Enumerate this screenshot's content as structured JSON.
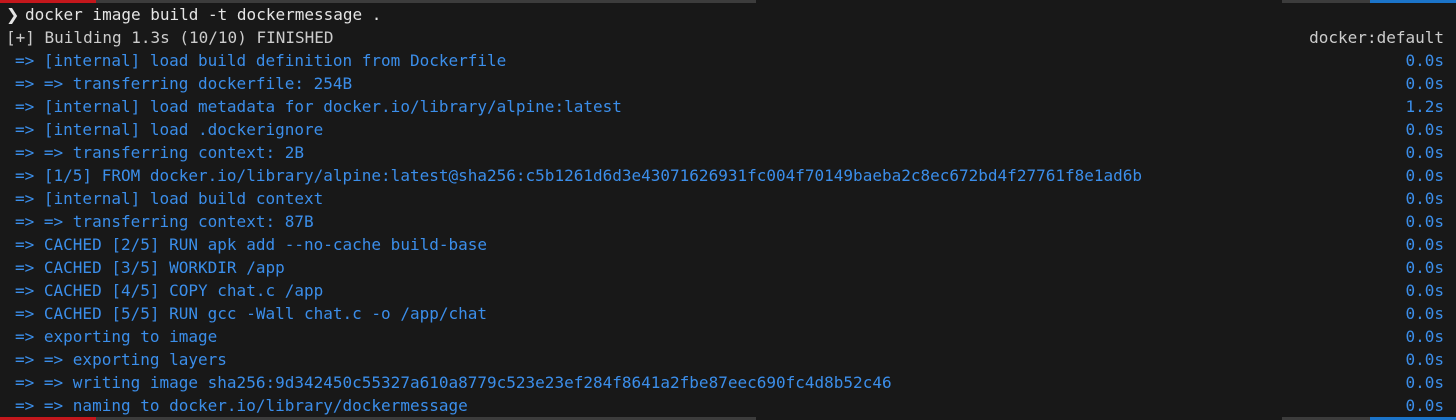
{
  "colors": {
    "background": "#181818",
    "text": "#cccccc",
    "command_text": "#e5e5e5",
    "step_text": "#3b8eea",
    "accent_red": "#c4171c",
    "accent_blue": "#1b74c9",
    "bar_gray": "#3c3c3c"
  },
  "prompt": {
    "chevron": "❯",
    "command": "docker image build -t dockermessage ."
  },
  "header": {
    "status": "[+] Building 1.3s (10/10) FINISHED",
    "builder": "docker:default"
  },
  "steps": [
    {
      "text": "=> [internal] load build definition from Dockerfile",
      "time": "0.0s"
    },
    {
      "text": "=> => transferring dockerfile: 254B",
      "time": "0.0s"
    },
    {
      "text": "=> [internal] load metadata for docker.io/library/alpine:latest",
      "time": "1.2s"
    },
    {
      "text": "=> [internal] load .dockerignore",
      "time": "0.0s"
    },
    {
      "text": "=> => transferring context: 2B",
      "time": "0.0s"
    },
    {
      "text": "=> [1/5] FROM docker.io/library/alpine:latest@sha256:c5b1261d6d3e43071626931fc004f70149baeba2c8ec672bd4f27761f8e1ad6b",
      "time": "0.0s"
    },
    {
      "text": "=> [internal] load build context",
      "time": "0.0s"
    },
    {
      "text": "=> => transferring context: 87B",
      "time": "0.0s"
    },
    {
      "text": "=> CACHED [2/5] RUN apk add --no-cache build-base",
      "time": "0.0s"
    },
    {
      "text": "=> CACHED [3/5] WORKDIR /app",
      "time": "0.0s"
    },
    {
      "text": "=> CACHED [4/5] COPY chat.c /app",
      "time": "0.0s"
    },
    {
      "text": "=> CACHED [5/5] RUN gcc -Wall chat.c -o /app/chat",
      "time": "0.0s"
    },
    {
      "text": "=> exporting to image",
      "time": "0.0s"
    },
    {
      "text": "=> => exporting layers",
      "time": "0.0s"
    },
    {
      "text": "=> => writing image sha256:9d342450c55327a610a8779c523e23ef284f8641a2fbe87eec690fc4d8b52c46",
      "time": "0.0s"
    },
    {
      "text": "=> => naming to docker.io/library/dockermessage",
      "time": "0.0s"
    }
  ]
}
